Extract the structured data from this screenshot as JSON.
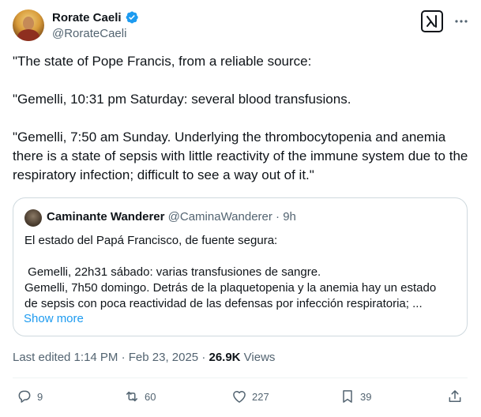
{
  "author": {
    "display_name": "Rorate Caeli",
    "handle": "@RorateCaeli"
  },
  "tweet": {
    "paragraphs": [
      "\"The state of Pope Francis, from a reliable source:",
      "\"Gemelli, 10:31 pm Saturday: several blood transfusions.",
      "\"Gemelli, 7:50 am Sunday. Underlying the thrombocytopenia and anemia there is a state of sepsis with little reactivity of the immune system due to the respiratory infection; difficult to see a way out of it.\""
    ]
  },
  "quote": {
    "display_name": "Caminante Wanderer",
    "handle": "@CaminaWanderer",
    "separator": "·",
    "time": "9h",
    "lines": [
      "El estado del Papá Francisco, de fuente segura:",
      "",
      " Gemelli, 22h31 sábado: varias transfusiones de sangre.",
      "Gemelli, 7h50 domingo. Detrás de la plaquetopenia y la anemia hay un estado",
      "de sepsis con poca reactividad de las defensas por infección respiratoria; ..."
    ],
    "show_more": "Show more"
  },
  "meta": {
    "edited": "Last edited 1:14 PM · Feb 23, 2025 · ",
    "views_count": "26.9K",
    "views_label": " Views"
  },
  "actions": {
    "replies": "9",
    "reposts": "60",
    "likes": "227",
    "bookmarks": "39"
  },
  "icons": [
    "verified-badge-icon",
    "grok-icon",
    "more-icon",
    "reply-icon",
    "repost-icon",
    "like-icon",
    "bookmark-icon",
    "share-icon"
  ],
  "colors": {
    "text": "#0f1419",
    "secondary": "#536471",
    "accent": "#1d9bf0",
    "border": "#cfd9de"
  }
}
